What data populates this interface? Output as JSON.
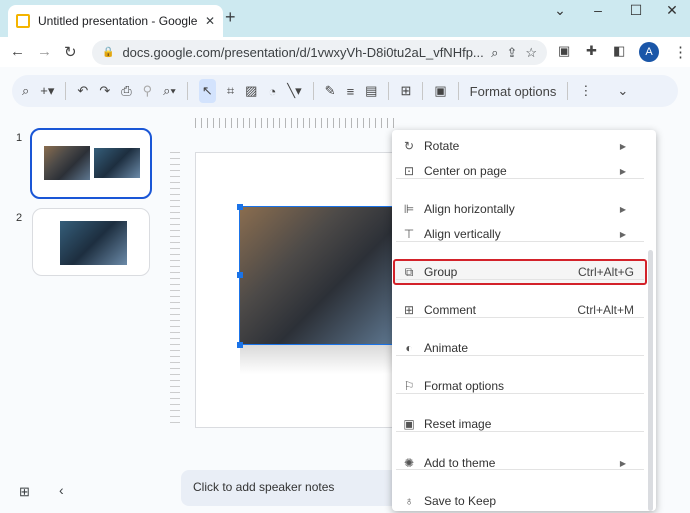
{
  "browser": {
    "tab_title": "Untitled presentation - Google Slides",
    "url": "docs.google.com/presentation/d/1vwxyVh-D8i0tu2aL_vfNHfp...",
    "avatar": "A"
  },
  "toolbar": {
    "format_options": "Format options"
  },
  "slides": [
    {
      "number": "1",
      "selected": true
    },
    {
      "number": "2",
      "selected": false
    }
  ],
  "notes": {
    "placeholder": "Click to add speaker notes"
  },
  "context_menu": {
    "items": [
      {
        "label": "Rotate",
        "icon": "rotate-icon",
        "submenu": true,
        "shortcut": ""
      },
      {
        "label": "Center on page",
        "icon": "center-icon",
        "submenu": true,
        "shortcut": ""
      },
      {
        "label": "Align horizontally",
        "icon": "align-horizontal-icon",
        "submenu": true,
        "shortcut": ""
      },
      {
        "label": "Align vertically",
        "icon": "align-vertical-icon",
        "submenu": true,
        "shortcut": ""
      },
      {
        "label": "Group",
        "icon": "group-icon",
        "submenu": false,
        "shortcut": "Ctrl+Alt+G",
        "highlighted": true
      },
      {
        "label": "Comment",
        "icon": "comment-icon",
        "submenu": false,
        "shortcut": "Ctrl+Alt+M"
      },
      {
        "label": "Animate",
        "icon": "animate-icon",
        "submenu": false,
        "shortcut": ""
      },
      {
        "label": "Format options",
        "icon": "format-options-icon",
        "submenu": false,
        "shortcut": ""
      },
      {
        "label": "Reset image",
        "icon": "reset-image-icon",
        "submenu": false,
        "shortcut": ""
      },
      {
        "label": "Add to theme",
        "icon": "palette-icon",
        "submenu": true,
        "shortcut": ""
      },
      {
        "label": "Save to Keep",
        "icon": "lightbulb-icon",
        "submenu": false,
        "shortcut": ""
      }
    ]
  },
  "colors": {
    "highlight_border": "#d3222a",
    "selection": "#1a73e8",
    "tab_bar": "#cde9f0"
  }
}
